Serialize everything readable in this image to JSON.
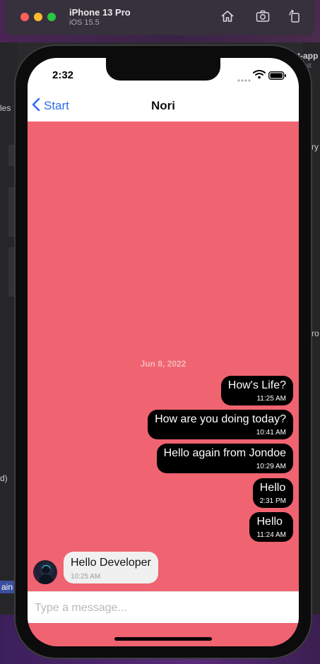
{
  "simulator": {
    "device": "iPhone 13 Pro",
    "os": "iOS 15.5"
  },
  "desktop": {
    "side_fragments": [
      "les",
      "t-app",
      "just",
      "ry",
      "ro",
      "d)",
      "ain"
    ]
  },
  "status_bar": {
    "time": "2:32"
  },
  "nav": {
    "back_label": "Start",
    "title": "Nori"
  },
  "chat": {
    "date_separator": "Jun 8, 2022",
    "outgoing": [
      {
        "text": "How's Life?",
        "time": "11:25 AM"
      },
      {
        "text": "How are you doing today?",
        "time": "10:41 AM"
      },
      {
        "text": "Hello again from Jondoe",
        "time": "10:29 AM"
      },
      {
        "text": "Hello",
        "time": "2:31 PM"
      },
      {
        "text": "Hello",
        "time": "11:24 AM"
      }
    ],
    "incoming": [
      {
        "text": "Hello Developer",
        "time": "10:25 AM"
      }
    ]
  },
  "composer": {
    "placeholder": "Type a message..."
  },
  "colors": {
    "chat_background": "#f06370",
    "accent": "#2f6bf0",
    "outgoing_bubble": "#000000",
    "incoming_bubble": "#f0f0f0"
  }
}
